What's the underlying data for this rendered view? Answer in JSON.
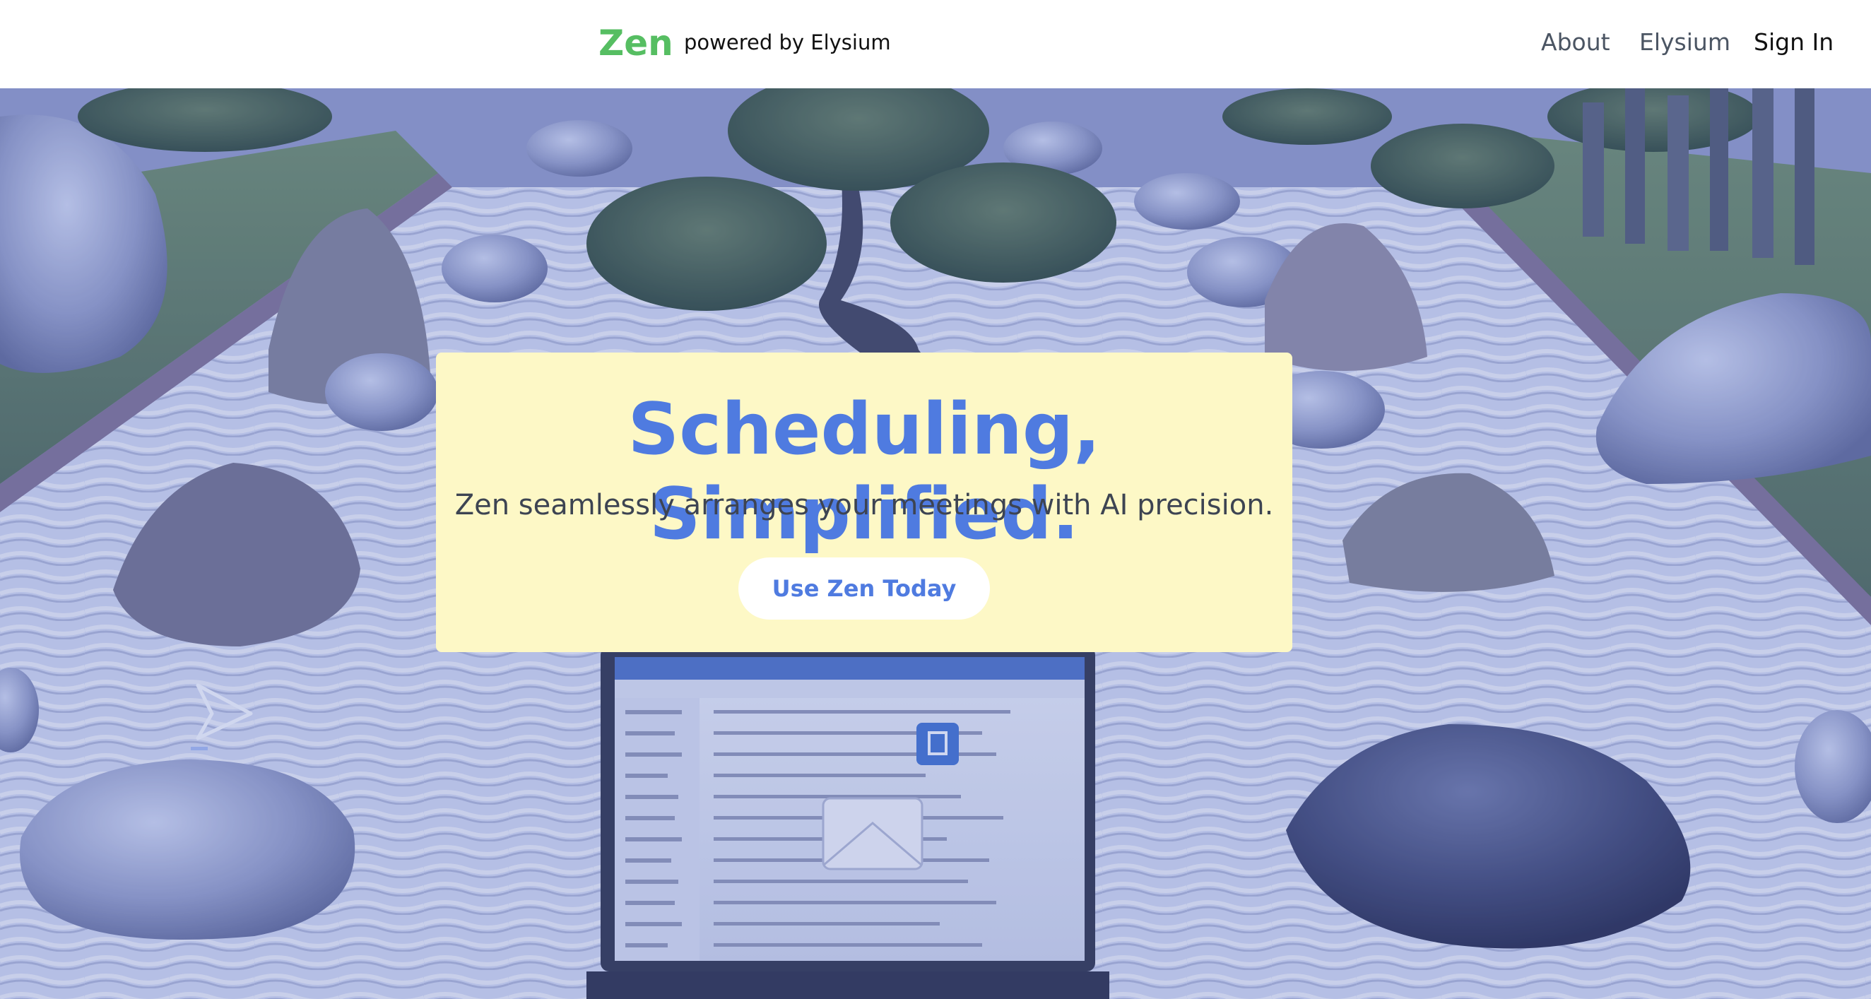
{
  "navbar": {
    "brand": "Zen",
    "powered_by": "powered by Elysium",
    "links": {
      "about": "About",
      "elysium": "Elysium",
      "sign_in": "Sign In"
    }
  },
  "hero": {
    "background": "zen-garden-illustration",
    "headline": "Scheduling, Simplified.",
    "subheadline": "Zen seamlessly arranges your meetings with AI precision.",
    "cta_label": "Use Zen Today"
  },
  "colors": {
    "brand_green": "#56be62",
    "accent_blue": "#4f7be0",
    "card_background": "#fdf8c6",
    "nav_background": "#ffffff"
  }
}
